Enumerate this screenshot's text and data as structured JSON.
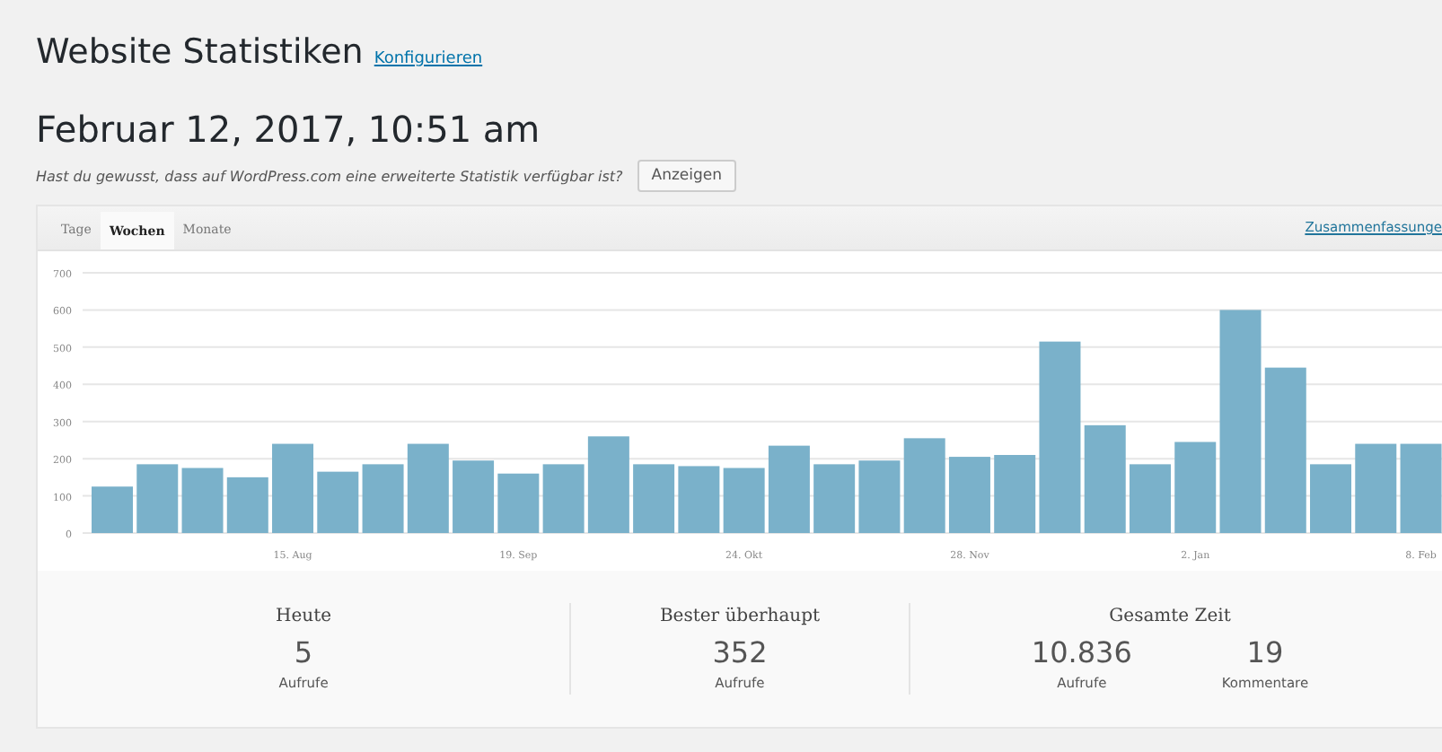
{
  "header": {
    "title": "Website Statistiken",
    "configure_link": "Konfigurieren"
  },
  "date": "Februar 12, 2017, 10:51 am",
  "notice": {
    "text": "Hast du gewusst, dass auf WordPress.com eine erweiterte Statistik verfügbar ist?",
    "button": "Anzeigen"
  },
  "panel": {
    "tabs": [
      {
        "label": "Tage",
        "selected": false
      },
      {
        "label": "Wochen",
        "selected": true
      },
      {
        "label": "Monate",
        "selected": false
      }
    ],
    "summary_link": "Zusammenfassunge",
    "chart_data": {
      "type": "bar",
      "grid": true,
      "ylim": [
        0,
        700
      ],
      "yticks": [
        0,
        100,
        200,
        300,
        400,
        500,
        600,
        700
      ],
      "categories": [
        null,
        null,
        null,
        null,
        "15. Aug",
        null,
        null,
        null,
        null,
        "19. Sep",
        null,
        null,
        null,
        null,
        "24. Okt",
        null,
        null,
        null,
        null,
        "28. Nov",
        null,
        null,
        null,
        null,
        "2. Jan",
        null,
        null,
        null,
        null,
        "8. Feb"
      ],
      "series": [
        {
          "color": "#7ab1ca",
          "values": [
            125,
            185,
            175,
            150,
            240,
            165,
            185,
            240,
            195,
            160,
            185,
            260,
            185,
            180,
            175,
            235,
            185,
            195,
            255,
            205,
            210,
            515,
            290,
            185,
            245,
            600,
            445,
            185,
            240,
            240
          ]
        }
      ]
    }
  },
  "stats": [
    {
      "title": "Heute",
      "items": [
        {
          "value": "5",
          "label": "Aufrufe"
        }
      ]
    },
    {
      "title": "Bester überhaupt",
      "items": [
        {
          "value": "352",
          "label": "Aufrufe"
        }
      ]
    },
    {
      "title": "Gesamte Zeit",
      "items": [
        {
          "value": "10.836",
          "label": "Aufrufe"
        },
        {
          "value": "19",
          "label": "Kommentare"
        }
      ]
    }
  ]
}
